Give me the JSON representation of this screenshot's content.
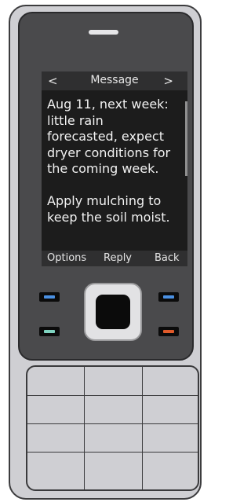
{
  "screen": {
    "header": {
      "left_arrow": "<",
      "title": "Message",
      "right_arrow": ">"
    },
    "message": "Aug 11, next week:\nlittle rain\nforecasted, expect\ndryer conditions for\nthe coming week.\n\nApply mulching to\nkeep the soil moist.",
    "softkeys": {
      "left": "Options",
      "middle": "Reply",
      "right": "Back"
    }
  },
  "key_colors": {
    "left_top": "#4a90e2",
    "right_top": "#4a90e2",
    "left_bottom": "#7fd3c0",
    "right_bottom": "#e05a2a"
  }
}
